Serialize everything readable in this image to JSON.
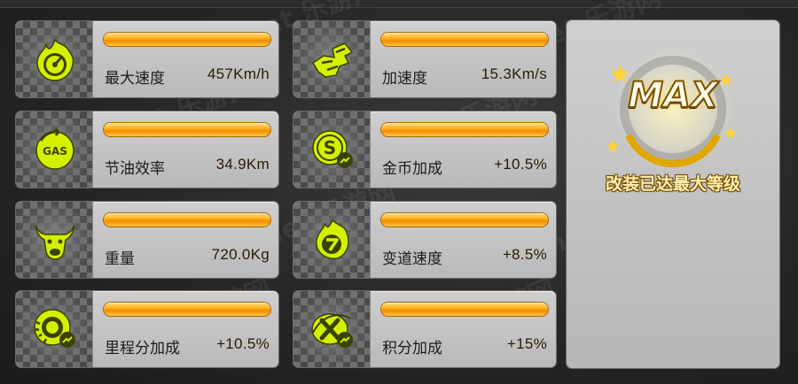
{
  "stats": [
    {
      "icon": "speedometer-icon",
      "label": "最大速度",
      "value": "457Km/h"
    },
    {
      "icon": "acceleration-icon",
      "label": "加速度",
      "value": "15.3Km/s"
    },
    {
      "icon": "gas-icon",
      "label": "节油效率",
      "value": "34.9Km"
    },
    {
      "icon": "coin-bonus-icon",
      "label": "金币加成",
      "value": "+10.5%"
    },
    {
      "icon": "bull-icon",
      "label": "重量",
      "value": "720.0Kg"
    },
    {
      "icon": "lane-change-icon",
      "label": "变道速度",
      "value": "+8.5%"
    },
    {
      "icon": "tire-icon",
      "label": "里程分加成",
      "value": "+10.5%"
    },
    {
      "icon": "score-bonus-icon",
      "label": "积分加成",
      "value": "+15%"
    }
  ],
  "max_panel": {
    "badge": "MAX",
    "caption": "改装已达最大等级"
  },
  "watermark": "962.net 乐游网",
  "colors": {
    "icon_accent": "#d4f000",
    "bar_orange": "#ff9c00",
    "card_bg": "#c4c4c4"
  }
}
